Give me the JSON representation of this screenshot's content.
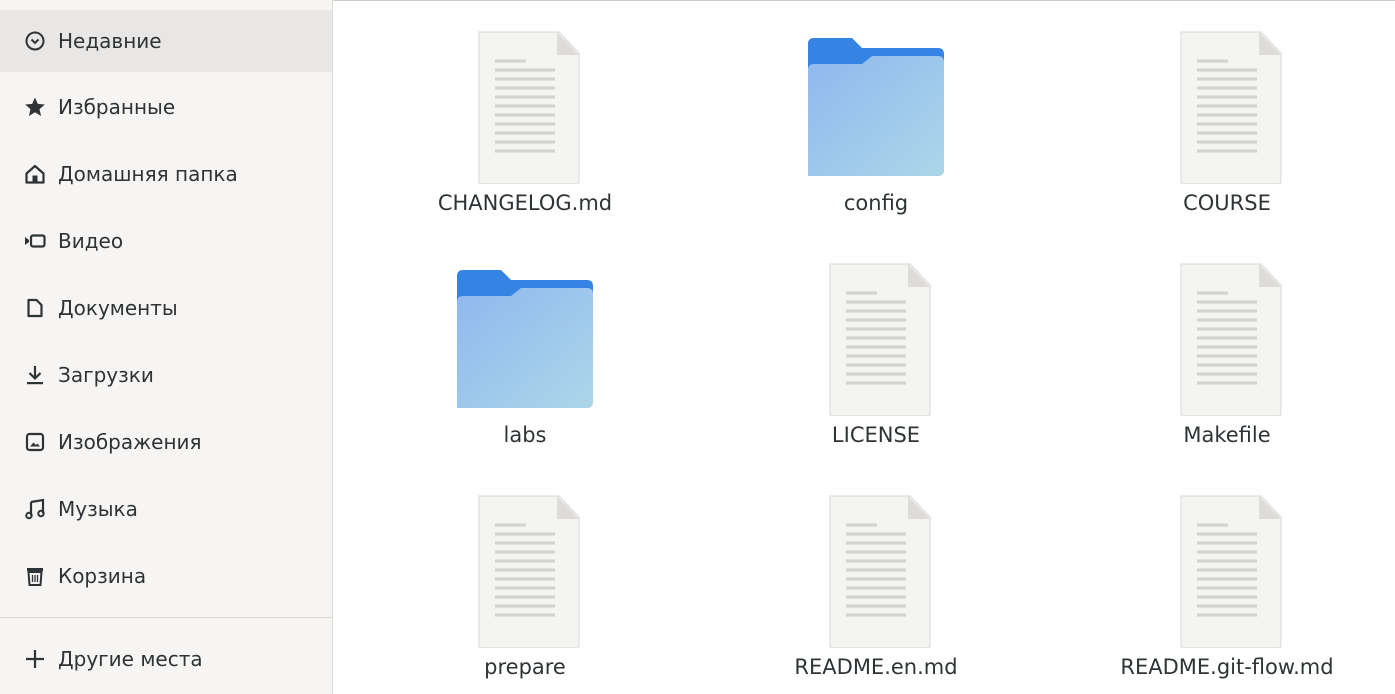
{
  "sidebar": {
    "items": [
      {
        "label": "Недавние",
        "icon": "clock-icon",
        "active": true
      },
      {
        "label": "Избранные",
        "icon": "star-icon"
      },
      {
        "label": "Домашняя папка",
        "icon": "home-icon"
      },
      {
        "label": "Видео",
        "icon": "video-icon"
      },
      {
        "label": "Документы",
        "icon": "document-icon"
      },
      {
        "label": "Загрузки",
        "icon": "download-icon"
      },
      {
        "label": "Изображения",
        "icon": "image-icon"
      },
      {
        "label": "Музыка",
        "icon": "music-icon"
      },
      {
        "label": "Корзина",
        "icon": "trash-icon"
      }
    ],
    "other_places": {
      "label": "Другие места",
      "icon": "plus-icon"
    }
  },
  "files": [
    {
      "name": "CHANGELOG.md",
      "type": "text-file-icon"
    },
    {
      "name": "config",
      "type": "folder-icon"
    },
    {
      "name": "COURSE",
      "type": "text-file-icon"
    },
    {
      "name": "labs",
      "type": "folder-icon"
    },
    {
      "name": "LICENSE",
      "type": "text-file-icon"
    },
    {
      "name": "Makefile",
      "type": "text-file-icon"
    },
    {
      "name": "prepare",
      "type": "text-file-icon"
    },
    {
      "name": "README.en.md",
      "type": "text-file-icon"
    },
    {
      "name": "README.git-flow.md",
      "type": "text-file-icon"
    }
  ],
  "colors": {
    "folder_top": "#3584e4",
    "folder_body": "#99c1f1",
    "file_paper": "#f4f4f2",
    "sidebar_bg": "#f6f5f4",
    "sidebar_active": "#e8e7e6"
  }
}
